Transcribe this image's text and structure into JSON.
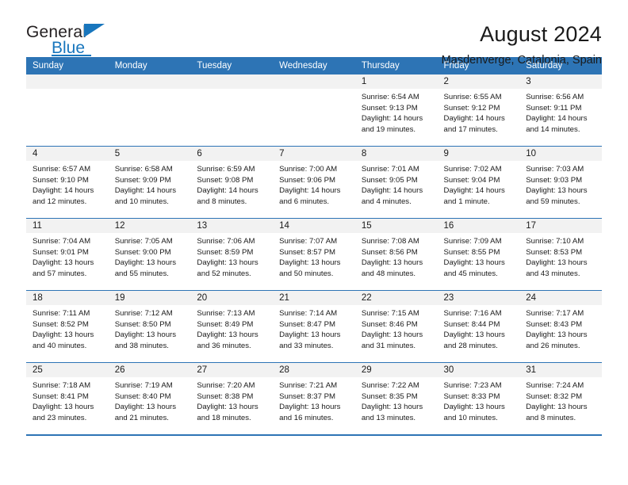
{
  "brand": {
    "name_primary": "General",
    "name_secondary": "Blue"
  },
  "header": {
    "title": "August 2024",
    "subtitle": "Masdenverge, Catalonia, Spain"
  },
  "weekday_headers": [
    "Sunday",
    "Monday",
    "Tuesday",
    "Wednesday",
    "Thursday",
    "Friday",
    "Saturday"
  ],
  "colors": {
    "header_blue": "#2d74b5",
    "brand_blue": "#1876bd",
    "daynum_band": "#f2f2f2",
    "text": "#1a1a1a"
  },
  "weeks": [
    [
      {
        "day": "",
        "empty": true,
        "sunrise": "",
        "sunset": "",
        "daylight1": "",
        "daylight2": ""
      },
      {
        "day": "",
        "empty": true,
        "sunrise": "",
        "sunset": "",
        "daylight1": "",
        "daylight2": ""
      },
      {
        "day": "",
        "empty": true,
        "sunrise": "",
        "sunset": "",
        "daylight1": "",
        "daylight2": ""
      },
      {
        "day": "",
        "empty": true,
        "sunrise": "",
        "sunset": "",
        "daylight1": "",
        "daylight2": ""
      },
      {
        "day": "1",
        "sunrise": "Sunrise: 6:54 AM",
        "sunset": "Sunset: 9:13 PM",
        "daylight1": "Daylight: 14 hours",
        "daylight2": "and 19 minutes."
      },
      {
        "day": "2",
        "sunrise": "Sunrise: 6:55 AM",
        "sunset": "Sunset: 9:12 PM",
        "daylight1": "Daylight: 14 hours",
        "daylight2": "and 17 minutes."
      },
      {
        "day": "3",
        "sunrise": "Sunrise: 6:56 AM",
        "sunset": "Sunset: 9:11 PM",
        "daylight1": "Daylight: 14 hours",
        "daylight2": "and 14 minutes."
      }
    ],
    [
      {
        "day": "4",
        "sunrise": "Sunrise: 6:57 AM",
        "sunset": "Sunset: 9:10 PM",
        "daylight1": "Daylight: 14 hours",
        "daylight2": "and 12 minutes."
      },
      {
        "day": "5",
        "sunrise": "Sunrise: 6:58 AM",
        "sunset": "Sunset: 9:09 PM",
        "daylight1": "Daylight: 14 hours",
        "daylight2": "and 10 minutes."
      },
      {
        "day": "6",
        "sunrise": "Sunrise: 6:59 AM",
        "sunset": "Sunset: 9:08 PM",
        "daylight1": "Daylight: 14 hours",
        "daylight2": "and 8 minutes."
      },
      {
        "day": "7",
        "sunrise": "Sunrise: 7:00 AM",
        "sunset": "Sunset: 9:06 PM",
        "daylight1": "Daylight: 14 hours",
        "daylight2": "and 6 minutes."
      },
      {
        "day": "8",
        "sunrise": "Sunrise: 7:01 AM",
        "sunset": "Sunset: 9:05 PM",
        "daylight1": "Daylight: 14 hours",
        "daylight2": "and 4 minutes."
      },
      {
        "day": "9",
        "sunrise": "Sunrise: 7:02 AM",
        "sunset": "Sunset: 9:04 PM",
        "daylight1": "Daylight: 14 hours",
        "daylight2": "and 1 minute."
      },
      {
        "day": "10",
        "sunrise": "Sunrise: 7:03 AM",
        "sunset": "Sunset: 9:03 PM",
        "daylight1": "Daylight: 13 hours",
        "daylight2": "and 59 minutes."
      }
    ],
    [
      {
        "day": "11",
        "sunrise": "Sunrise: 7:04 AM",
        "sunset": "Sunset: 9:01 PM",
        "daylight1": "Daylight: 13 hours",
        "daylight2": "and 57 minutes."
      },
      {
        "day": "12",
        "sunrise": "Sunrise: 7:05 AM",
        "sunset": "Sunset: 9:00 PM",
        "daylight1": "Daylight: 13 hours",
        "daylight2": "and 55 minutes."
      },
      {
        "day": "13",
        "sunrise": "Sunrise: 7:06 AM",
        "sunset": "Sunset: 8:59 PM",
        "daylight1": "Daylight: 13 hours",
        "daylight2": "and 52 minutes."
      },
      {
        "day": "14",
        "sunrise": "Sunrise: 7:07 AM",
        "sunset": "Sunset: 8:57 PM",
        "daylight1": "Daylight: 13 hours",
        "daylight2": "and 50 minutes."
      },
      {
        "day": "15",
        "sunrise": "Sunrise: 7:08 AM",
        "sunset": "Sunset: 8:56 PM",
        "daylight1": "Daylight: 13 hours",
        "daylight2": "and 48 minutes."
      },
      {
        "day": "16",
        "sunrise": "Sunrise: 7:09 AM",
        "sunset": "Sunset: 8:55 PM",
        "daylight1": "Daylight: 13 hours",
        "daylight2": "and 45 minutes."
      },
      {
        "day": "17",
        "sunrise": "Sunrise: 7:10 AM",
        "sunset": "Sunset: 8:53 PM",
        "daylight1": "Daylight: 13 hours",
        "daylight2": "and 43 minutes."
      }
    ],
    [
      {
        "day": "18",
        "sunrise": "Sunrise: 7:11 AM",
        "sunset": "Sunset: 8:52 PM",
        "daylight1": "Daylight: 13 hours",
        "daylight2": "and 40 minutes."
      },
      {
        "day": "19",
        "sunrise": "Sunrise: 7:12 AM",
        "sunset": "Sunset: 8:50 PM",
        "daylight1": "Daylight: 13 hours",
        "daylight2": "and 38 minutes."
      },
      {
        "day": "20",
        "sunrise": "Sunrise: 7:13 AM",
        "sunset": "Sunset: 8:49 PM",
        "daylight1": "Daylight: 13 hours",
        "daylight2": "and 36 minutes."
      },
      {
        "day": "21",
        "sunrise": "Sunrise: 7:14 AM",
        "sunset": "Sunset: 8:47 PM",
        "daylight1": "Daylight: 13 hours",
        "daylight2": "and 33 minutes."
      },
      {
        "day": "22",
        "sunrise": "Sunrise: 7:15 AM",
        "sunset": "Sunset: 8:46 PM",
        "daylight1": "Daylight: 13 hours",
        "daylight2": "and 31 minutes."
      },
      {
        "day": "23",
        "sunrise": "Sunrise: 7:16 AM",
        "sunset": "Sunset: 8:44 PM",
        "daylight1": "Daylight: 13 hours",
        "daylight2": "and 28 minutes."
      },
      {
        "day": "24",
        "sunrise": "Sunrise: 7:17 AM",
        "sunset": "Sunset: 8:43 PM",
        "daylight1": "Daylight: 13 hours",
        "daylight2": "and 26 minutes."
      }
    ],
    [
      {
        "day": "25",
        "sunrise": "Sunrise: 7:18 AM",
        "sunset": "Sunset: 8:41 PM",
        "daylight1": "Daylight: 13 hours",
        "daylight2": "and 23 minutes."
      },
      {
        "day": "26",
        "sunrise": "Sunrise: 7:19 AM",
        "sunset": "Sunset: 8:40 PM",
        "daylight1": "Daylight: 13 hours",
        "daylight2": "and 21 minutes."
      },
      {
        "day": "27",
        "sunrise": "Sunrise: 7:20 AM",
        "sunset": "Sunset: 8:38 PM",
        "daylight1": "Daylight: 13 hours",
        "daylight2": "and 18 minutes."
      },
      {
        "day": "28",
        "sunrise": "Sunrise: 7:21 AM",
        "sunset": "Sunset: 8:37 PM",
        "daylight1": "Daylight: 13 hours",
        "daylight2": "and 16 minutes."
      },
      {
        "day": "29",
        "sunrise": "Sunrise: 7:22 AM",
        "sunset": "Sunset: 8:35 PM",
        "daylight1": "Daylight: 13 hours",
        "daylight2": "and 13 minutes."
      },
      {
        "day": "30",
        "sunrise": "Sunrise: 7:23 AM",
        "sunset": "Sunset: 8:33 PM",
        "daylight1": "Daylight: 13 hours",
        "daylight2": "and 10 minutes."
      },
      {
        "day": "31",
        "sunrise": "Sunrise: 7:24 AM",
        "sunset": "Sunset: 8:32 PM",
        "daylight1": "Daylight: 13 hours",
        "daylight2": "and 8 minutes."
      }
    ]
  ]
}
